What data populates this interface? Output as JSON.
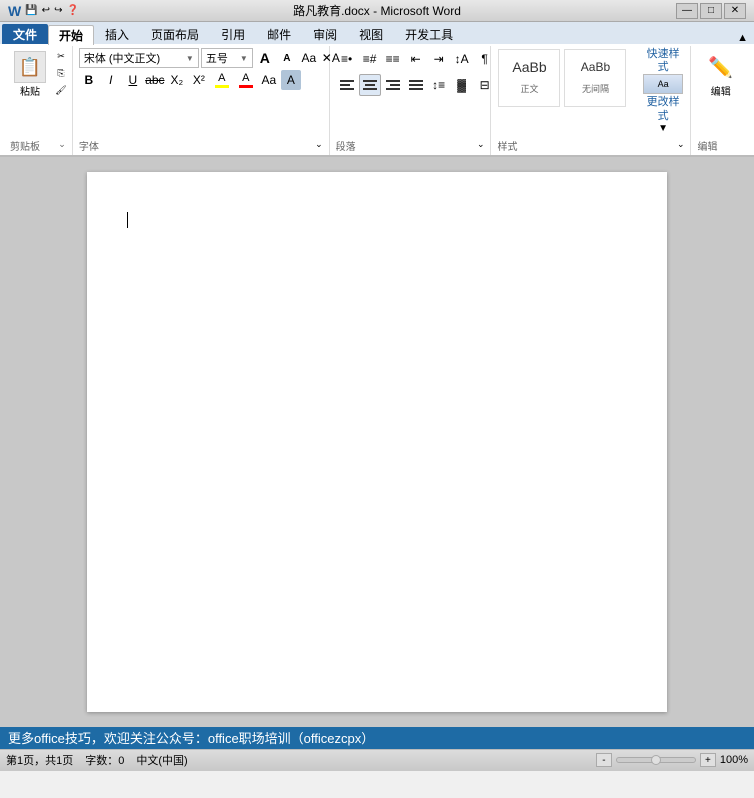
{
  "titlebar": {
    "title": "路凡教育.docx - Microsoft Word",
    "minimize": "—",
    "restore": "□",
    "close": "✕"
  },
  "qat": {
    "save": "💾",
    "undo": "↩",
    "redo": "↪",
    "help": "?"
  },
  "tabs": [
    {
      "label": "文件",
      "active": false
    },
    {
      "label": "开始",
      "active": true
    },
    {
      "label": "插入",
      "active": false
    },
    {
      "label": "页面布局",
      "active": false
    },
    {
      "label": "引用",
      "active": false
    },
    {
      "label": "邮件",
      "active": false
    },
    {
      "label": "审阅",
      "active": false
    },
    {
      "label": "视图",
      "active": false
    },
    {
      "label": "开发工具",
      "active": false
    }
  ],
  "ribbon": {
    "clipboard": {
      "label": "剪贴板",
      "paste": "粘贴",
      "cut": "✂",
      "copy": "⎘",
      "format": "✒"
    },
    "font": {
      "label": "字体",
      "fontName": "宋体 (中文正文)",
      "fontSize": "五号",
      "bold": "B",
      "italic": "I",
      "underline": "U",
      "strikethrough": "abc",
      "sub": "X₂",
      "super": "X²",
      "clearFormat": "A",
      "grow": "A↑",
      "shrink": "A↓",
      "fontColor": "A",
      "fontColorBar": "#ff0000",
      "highlight": "A",
      "highlightBar": "#ffff00",
      "fontStyle": "Aa",
      "textEffect": "A"
    },
    "paragraph": {
      "label": "段落",
      "bullets": "☰",
      "numbering": "☰#",
      "multilevel": "☰≡",
      "decreaseIndent": "⇤",
      "increaseIndent": "⇥",
      "sort": "↕A",
      "showMarks": "¶",
      "alignLeft": "≡",
      "alignCenter": "≡",
      "alignRight": "≡",
      "justify": "≡",
      "lineSpacing": "≡↕",
      "shading": "▓",
      "border": "□"
    },
    "styles": {
      "label": "样式",
      "quickStyle": "快速样式",
      "changeStyle": "更改样式",
      "edit": "编辑"
    },
    "editing": {
      "label": "编辑"
    }
  },
  "document": {
    "cursorVisible": true
  },
  "statusbar": {
    "message": "更多office技巧，欢迎关注公众号：office职场培训（officezcpx）"
  },
  "bottombar": {
    "pageInfo": "第1页，共1页",
    "wordCount": "字数：0",
    "language": "中文(中国)",
    "zoom": "100%"
  }
}
